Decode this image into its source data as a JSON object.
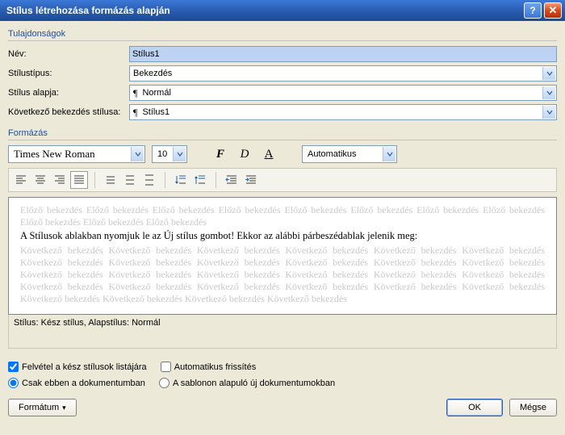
{
  "title": "Stílus létrehozása formázás alapján",
  "groups": {
    "props": "Tulajdonságok",
    "format": "Formázás"
  },
  "props": {
    "name_label": "Név:",
    "name_value": "Stílus1",
    "type_label": "Stílustípus:",
    "type_value": "Bekezdés",
    "base_label": "Stílus alapja:",
    "base_value": "Normál",
    "next_label": "Következő bekezdés stílusa:",
    "next_value": "Stílus1"
  },
  "format": {
    "font": "Times New Roman",
    "size": "10",
    "bold": "F",
    "italic": "D",
    "underline": "A",
    "color": "Automatikus"
  },
  "preview": {
    "prev": "Előző bekezdés Előző bekezdés Előző bekezdés Előző bekezdés Előző bekezdés Előző bekezdés Előző bekezdés Előző bekezdés Előző bekezdés Előző bekezdés Előző bekezdés",
    "sample": "A Stílusok ablakban nyomjuk le az Új stílus gombot! Ekkor az alábbi párbeszédablak jelenik meg:",
    "next": "Következő bekezdés Következő bekezdés Következő bekezdés Következő bekezdés Következő bekezdés Következő bekezdés Következő bekezdés Következő bekezdés Következő bekezdés Következő bekezdés Következő bekezdés Következő bekezdés Következő bekezdés Következő bekezdés Következő bekezdés Következő bekezdés Következő bekezdés Következő bekezdés Következő bekezdés Következő bekezdés Következő bekezdés Következő bekezdés Következő bekezdés Következő bekezdés Következő bekezdés Következő bekezdés Következő bekezdés Következő bekezdés"
  },
  "desc": "Stílus: Kész stílus, Alapstílus: Normál",
  "checks": {
    "addlist": "Felvétel a kész stílusok listájára",
    "autoupdate": "Automatikus frissítés",
    "thisdoc": "Csak ebben a dokumentumban",
    "newdocs": "A sablonon alapuló új dokumentumokban"
  },
  "buttons": {
    "format": "Formátum",
    "ok": "OK",
    "cancel": "Mégse"
  }
}
